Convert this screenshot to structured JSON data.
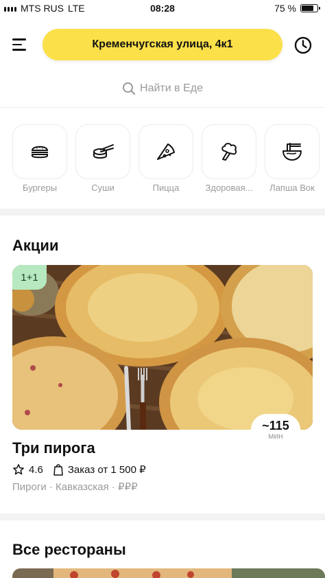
{
  "status_bar": {
    "carrier": "MTS RUS",
    "network": "LTE",
    "time": "08:28",
    "battery": "75 %",
    "battery_level": 0.75
  },
  "header": {
    "address": "Кременчугская улица, 4к1"
  },
  "search": {
    "placeholder": "Найти в Еде"
  },
  "categories": [
    {
      "label": "Бургеры",
      "icon": "burger-icon"
    },
    {
      "label": "Суши",
      "icon": "sushi-icon"
    },
    {
      "label": "Пицца",
      "icon": "pizza-icon"
    },
    {
      "label": "Здоровая...",
      "icon": "broccoli-icon"
    },
    {
      "label": "Лапша Вок",
      "icon": "noodles-icon"
    }
  ],
  "promo_section": {
    "title": "Акции",
    "card": {
      "badge": "1+1",
      "eta_value": "~115",
      "eta_unit": "мин",
      "name": "Три пирога",
      "rating": "4.6",
      "min_order": "Заказ от 1 500 ₽",
      "tags": "Пироги · Кавказская · ",
      "price_level": "₽₽₽"
    }
  },
  "all_section": {
    "title": "Все рестораны"
  },
  "colors": {
    "accent": "#fbe04a",
    "badge": "#b6e9c0",
    "muted": "#9a9a9a"
  }
}
